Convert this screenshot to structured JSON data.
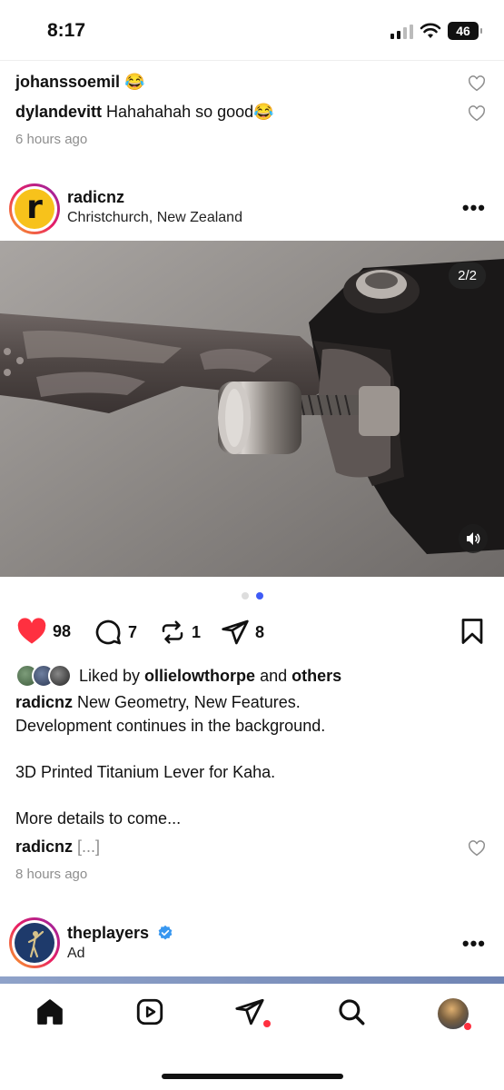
{
  "status": {
    "time": "8:17",
    "battery": "46"
  },
  "comments": [
    {
      "user": "johanssoemil",
      "text": "😂"
    },
    {
      "user": "dylandevitt",
      "text": "Hahahahah so good😂"
    }
  ],
  "prev_post_time": "6 hours ago",
  "post": {
    "avatar_letter": "r",
    "username": "radicnz",
    "location": "Christchurch, New Zealand",
    "more": "•••",
    "media_counter": "2/2",
    "carousel": {
      "count": 2,
      "active": 2
    },
    "likes": "98",
    "comments": "7",
    "reposts": "1",
    "shares": "8",
    "liked_by_prefix": "Liked by ",
    "liked_by_user": "ollielowthorpe",
    "liked_by_and": " and ",
    "liked_by_others": "others",
    "caption_user": "radicnz",
    "caption_lines": [
      " New Geometry, New Features.",
      "Development continues in the background.",
      "",
      "3D Printed Titanium Lever for Kaha.",
      "",
      "More details to come..."
    ],
    "reply_user": "radicnz",
    "reply_text": " [...]",
    "time": "8 hours ago"
  },
  "next_post": {
    "username": "theplayers",
    "subline": "Ad",
    "more": "•••"
  },
  "colors": {
    "like_red": "#ff3040",
    "verified_blue": "#3897f0",
    "dot_active": "#3f5bf6"
  }
}
